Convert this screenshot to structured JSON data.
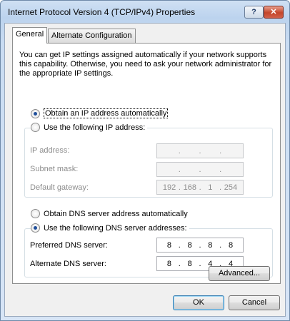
{
  "window": {
    "title": "Internet Protocol Version 4 (TCP/IPv4) Properties",
    "help_label": "?",
    "close_label": "✕"
  },
  "tabs": [
    {
      "label": "General",
      "active": true
    },
    {
      "label": "Alternate Configuration",
      "active": false
    }
  ],
  "description": "You can get IP settings assigned automatically if your network supports this capability. Otherwise, you need to ask your network administrator for the appropriate IP settings.",
  "ip_mode": {
    "auto_label": "Obtain an IP address automatically",
    "manual_label": "Use the following IP address:",
    "selected": "auto"
  },
  "ip_fields": {
    "ip_address": {
      "label": "IP address:",
      "value": [
        "",
        "",
        "",
        ""
      ]
    },
    "subnet_mask": {
      "label": "Subnet mask:",
      "value": [
        "",
        "",
        "",
        ""
      ]
    },
    "default_gateway": {
      "label": "Default gateway:",
      "value": [
        "192",
        "168",
        "1",
        "254"
      ]
    }
  },
  "dns_mode": {
    "auto_label": "Obtain DNS server address automatically",
    "manual_label": "Use the following DNS server addresses:",
    "selected": "manual"
  },
  "dns_fields": {
    "preferred": {
      "label": "Preferred DNS server:",
      "value": [
        "8",
        "8",
        "8",
        "8"
      ]
    },
    "alternate": {
      "label": "Alternate DNS server:",
      "value": [
        "8",
        "8",
        "4",
        "4"
      ]
    }
  },
  "buttons": {
    "advanced": "Advanced...",
    "ok": "OK",
    "cancel": "Cancel"
  }
}
